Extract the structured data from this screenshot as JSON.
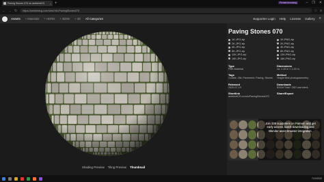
{
  "browser": {
    "tab_title": "Paving Stones 070 on ambientCG",
    "new_tab": "+",
    "private_badge": "Private browsing",
    "url": "https://ambientcg.com/view?id=PavingStones070",
    "win_controls": [
      "–",
      "❐",
      "✕"
    ]
  },
  "header": {
    "assets_label": "Assets",
    "crumbs": [
      "+ Materials",
      "+ HDRIs",
      "+ 3DMs",
      "+ 3D",
      "All Categories"
    ],
    "right_links": [
      "Supporter Login",
      "Help",
      "License",
      "Gallery"
    ],
    "search_icon": "search-icon"
  },
  "viewer": {
    "tabs": [
      "Shading Preview",
      "Tiling Preview",
      "Thumbnail"
    ],
    "active_tab": "Thumbnail"
  },
  "asset": {
    "title": "Paving Stones 070",
    "downloads": [
      "1K-JPG.zip",
      "1K-PNG.zip",
      "2K-JPG.zip",
      "2K-PNG.zip",
      "4K-JPG.zip",
      "4K-PNG.zip",
      "8K-JPG.zip",
      "8K-PNG.zip",
      "12K-JPG.zip",
      "12K-PNG.zip",
      "16K-JPG.zip",
      "16K-PNG.zip"
    ],
    "info": {
      "type_label": "Type",
      "type_value": "PBR-Material",
      "dimensions_label": "Dimensions",
      "dimensions_value": "ca. 1.15 m × 1.15 m",
      "tags_label": "Tags",
      "tags_value": "Cobble, Old, Pavement, Paving, Stones",
      "method_label": "Method",
      "method_value": "Height field photogrammetry",
      "released_label": "Released",
      "released_value": "2020-07-19",
      "downloads_label": "Downloads",
      "downloads_value": "83118 Total / 282 Last week",
      "shortlink_label": "Shortlink",
      "shortlink_value": "ambientCG.com/a/PavingStones070",
      "share_label": "Share/Export",
      "share_value": ""
    },
    "promo_text": "Join 338 supporters on Patreon and get early access, batch-downloading and Blender asset browser integration."
  },
  "taskbar": {
    "clock": "7/19/2020"
  },
  "colors": {
    "background": "#1b1b1b",
    "sidebar": "#222222",
    "stone": "#bdb8ac",
    "moss": "#4b5a30"
  }
}
